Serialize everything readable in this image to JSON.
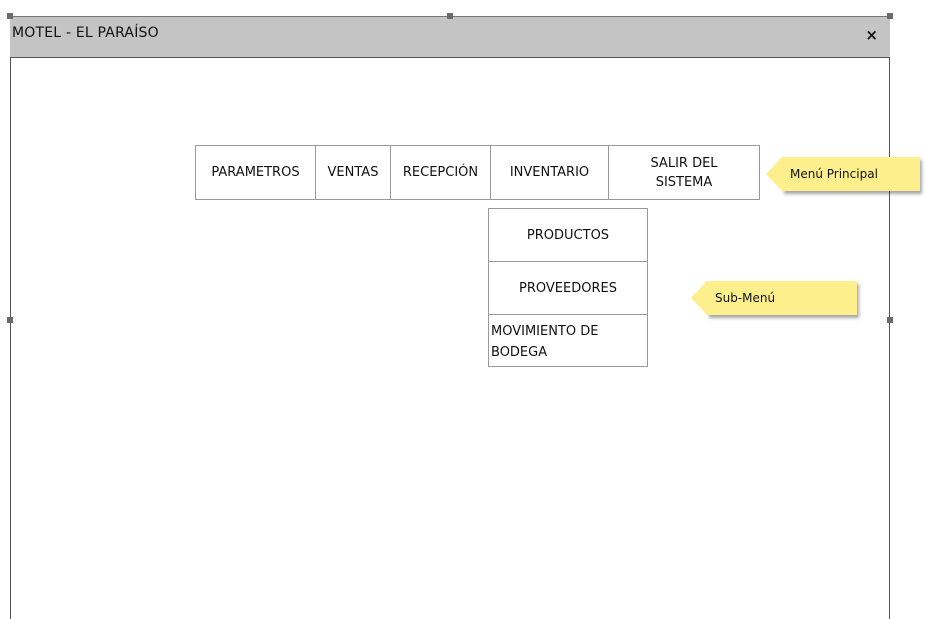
{
  "window": {
    "title": "MOTEL - EL PARAÍSO",
    "close_label": "×"
  },
  "main_menu": {
    "items": [
      {
        "label": "PARAMETROS"
      },
      {
        "label": "VENTAS"
      },
      {
        "label": "RECEPCIÓN"
      },
      {
        "label": "INVENTARIO"
      },
      {
        "label": "SALIR DEL\nSISTEMA"
      }
    ]
  },
  "submenu": {
    "items": [
      {
        "label": "PRODUCTOS"
      },
      {
        "label": "PROVEEDORES"
      },
      {
        "label": "MOVIMIENTO DE BODEGA"
      }
    ]
  },
  "annotations": {
    "main_menu_note": "Menú Principal",
    "submenu_note": "Sub-Menú"
  },
  "colors": {
    "titlebar": "#c4c4c4",
    "note": "#fdef8c"
  }
}
